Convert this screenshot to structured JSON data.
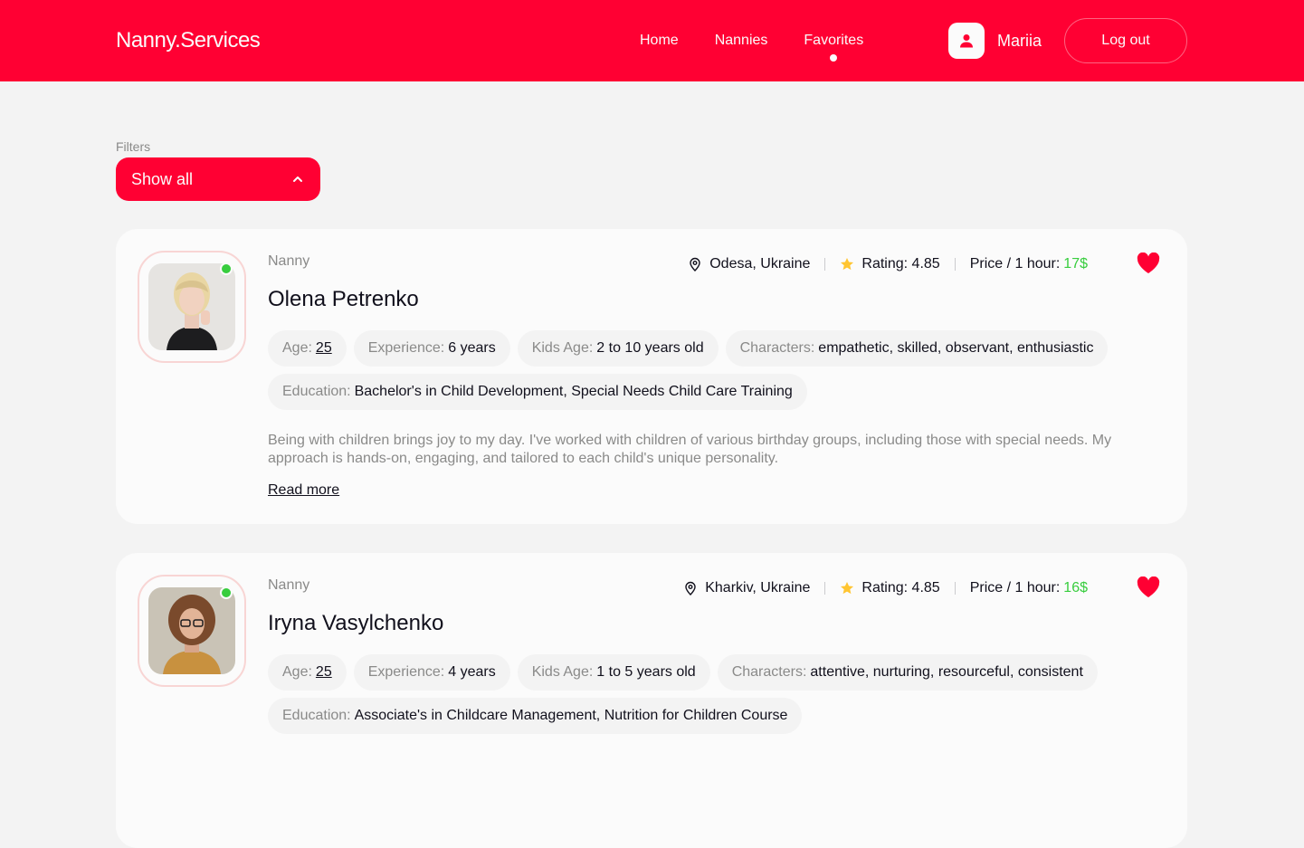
{
  "header": {
    "logo": "Nanny.Services",
    "nav": [
      {
        "label": "Home"
      },
      {
        "label": "Nannies"
      },
      {
        "label": "Favorites",
        "active": true
      }
    ],
    "user_name": "Mariia",
    "logout_label": "Log out",
    "accent_color": "#ff0033"
  },
  "filters": {
    "label": "Filters",
    "selected": "Show all"
  },
  "cards": [
    {
      "role": "Nanny",
      "name": "Olena Petrenko",
      "location": "Odesa, Ukraine",
      "rating_label": "Rating: 4.85",
      "price_label": "Price / 1 hour:",
      "price_value": "17$",
      "favorite": true,
      "online": true,
      "tags": {
        "age_key": "Age:",
        "age_val": "25",
        "exp_key": "Experience:",
        "exp_val": "6 years",
        "kids_key": "Kids Age:",
        "kids_val": "2 to 10 years old",
        "char_key": "Characters:",
        "char_val": "empathetic, skilled, observant, enthusiastic",
        "edu_key": "Education:",
        "edu_val": "Bachelor's in Child Development, Special Needs Child Care Training"
      },
      "description": "Being with children brings joy to my day. I've worked with children of various birthday groups, including those with special needs. My approach is hands-on, engaging, and tailored to each child's unique personality.",
      "read_more": "Read more"
    },
    {
      "role": "Nanny",
      "name": "Iryna Vasylchenko",
      "location": "Kharkiv, Ukraine",
      "rating_label": "Rating: 4.85",
      "price_label": "Price / 1 hour:",
      "price_value": "16$",
      "favorite": true,
      "online": true,
      "tags": {
        "age_key": "Age:",
        "age_val": "25",
        "exp_key": "Experience:",
        "exp_val": "4 years",
        "kids_key": "Kids Age:",
        "kids_val": "1 to 5 years old",
        "char_key": "Characters:",
        "char_val": "attentive, nurturing, resourceful, consistent",
        "edu_key": "Education:",
        "edu_val": "Associate's in Childcare Management, Nutrition for Children Course"
      }
    }
  ]
}
